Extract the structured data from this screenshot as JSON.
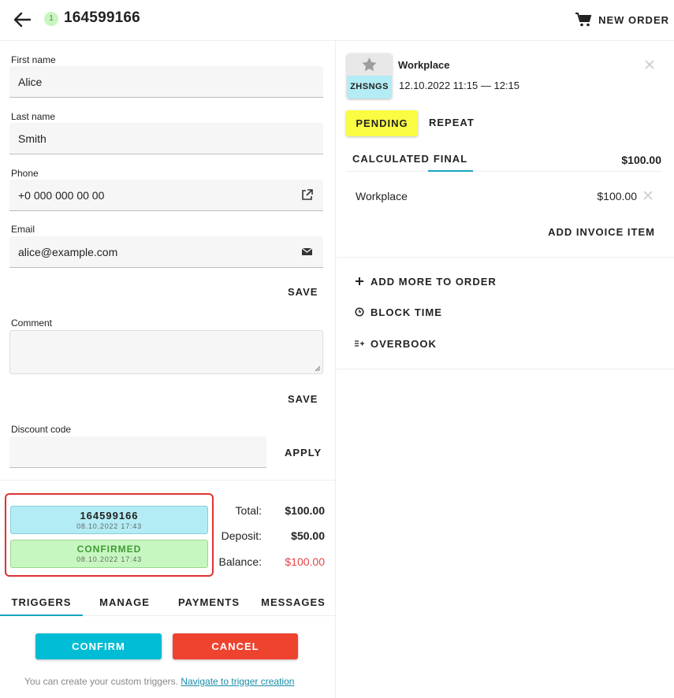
{
  "header": {
    "order_count": "1",
    "order_id": "164599166",
    "new_order_label": "NEW ORDER"
  },
  "form": {
    "first_name_label": "First name",
    "first_name_value": "Alice",
    "last_name_label": "Last name",
    "last_name_value": "Smith",
    "phone_label": "Phone",
    "phone_value": "+0 000 000 00 00",
    "email_label": "Email",
    "email_value": "alice@example.com",
    "save_label": "SAVE",
    "comment_label": "Comment",
    "comment_value": "",
    "comment_save_label": "SAVE",
    "discount_label": "Discount code",
    "discount_value": "",
    "apply_label": "APPLY"
  },
  "history": [
    {
      "title": "164599166",
      "date": "08.10.2022 17:43",
      "color": "#b3ecf4"
    },
    {
      "title": "CONFIRMED",
      "date": "08.10.2022 17:43",
      "color": "#c7f7c0"
    }
  ],
  "totals": {
    "total_label": "Total:",
    "total_value": "$100.00",
    "deposit_label": "Deposit:",
    "deposit_value": "$50.00",
    "balance_label": "Balance:",
    "balance_value": "$100.00"
  },
  "tabs": [
    {
      "label": "TRIGGERS",
      "active": true
    },
    {
      "label": "MANAGE",
      "active": false
    },
    {
      "label": "PAYMENTS",
      "active": false
    },
    {
      "label": "MESSAGES",
      "active": false
    }
  ],
  "triggers": {
    "confirm_label": "CONFIRM",
    "cancel_label": "CANCEL",
    "hint_text": "You can create your custom triggers.",
    "hint_link": "Navigate to trigger creation"
  },
  "service": {
    "code": "ZHSNGS",
    "title": "Workplace",
    "time": "12.10.2022 11:15 — 12:15",
    "status_label": "PENDING",
    "repeat_label": "REPEAT",
    "status_color": "#fafc43"
  },
  "invoice": {
    "tab_calculated": "CALCULATED",
    "tab_final": "FINAL",
    "total": "$100.00",
    "items": [
      {
        "name": "Workplace",
        "price": "$100.00"
      }
    ],
    "add_item_label": "ADD INVOICE ITEM"
  },
  "actions": [
    {
      "label": "ADD MORE TO ORDER",
      "icon": "plus-icon"
    },
    {
      "label": "BLOCK TIME",
      "icon": "clock-icon"
    },
    {
      "label": "OVERBOOK",
      "icon": "overbook-icon"
    }
  ],
  "colors": {
    "accent": "#00bcd4",
    "danger": "#ee432f",
    "highlight_border": "#e03232",
    "balance_red": "#e04545"
  }
}
